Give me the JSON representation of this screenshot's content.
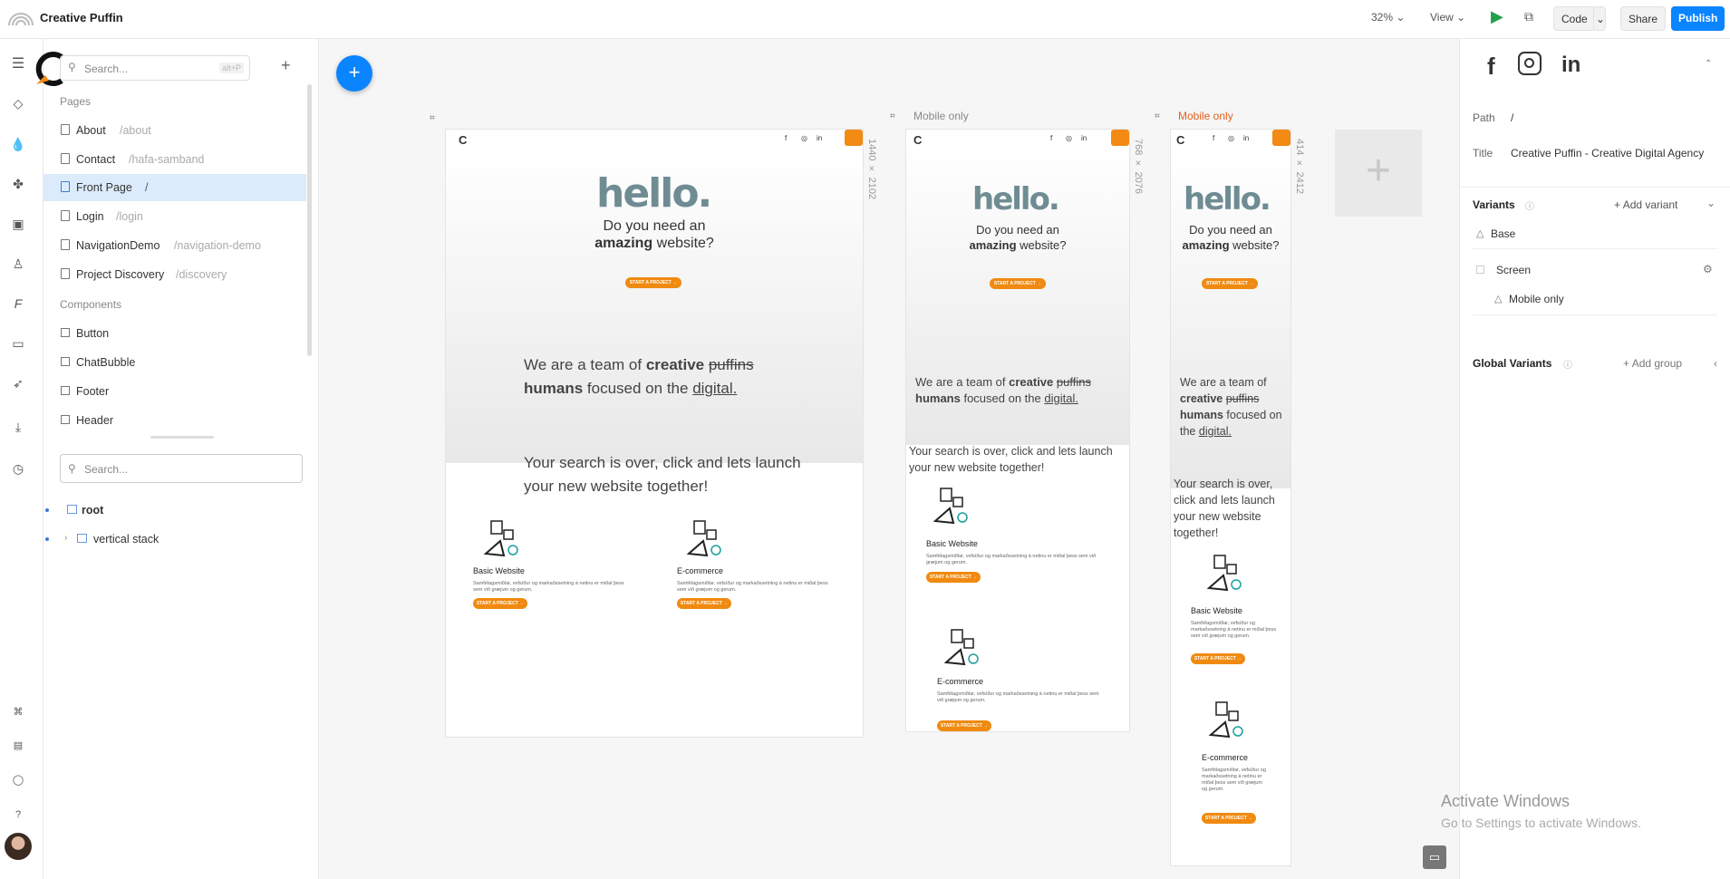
{
  "app": {
    "title": "Creative Puffin"
  },
  "topbar": {
    "zoom": "32%",
    "view_label": "View",
    "code_label": "Code",
    "share_label": "Share",
    "publish_label": "Publish",
    "accent": "#0a84ff"
  },
  "left": {
    "search_placeholder": "Search...",
    "search_shortcut": "alt+P",
    "pages_heading": "Pages",
    "pages": [
      {
        "name": "About",
        "path": "/about"
      },
      {
        "name": "Contact",
        "path": "/hafa-samband"
      },
      {
        "name": "Front Page",
        "path": "/"
      },
      {
        "name": "Login",
        "path": "/login"
      },
      {
        "name": "NavigationDemo",
        "path": "/navigation-demo"
      },
      {
        "name": "Project Discovery",
        "path": "/discovery"
      }
    ],
    "components_heading": "Components",
    "components": [
      "Button",
      "ChatBubble",
      "Footer",
      "Header"
    ],
    "tree_search_placeholder": "Search...",
    "tree": [
      "root",
      "vertical stack"
    ]
  },
  "canvas": {
    "frames": [
      {
        "label": "",
        "dims": "1440 × 2102"
      },
      {
        "label": "Mobile only",
        "dims": "768 × 2076"
      },
      {
        "label": "Mobile only",
        "dims": "414 × 2412"
      }
    ],
    "hello": "hello.",
    "sub1": "Do you need an",
    "sub2_bold": "amazing",
    "sub2_rest": "website?",
    "cta": "START A PROJECT →",
    "team_we": "We are a team of",
    "team_creative": "creative",
    "team_puffins": "puffins",
    "team_humans": "humans",
    "team_focused": "focused on the",
    "team_digital": "digital.",
    "search_text": "Your search is over, click and lets launch your new website together!",
    "cards": [
      {
        "title": "Basic Website",
        "desc": "Samfélagsmiðlar, vefsíður og markaðssetning á netinu er miðal þess sem við græjum og gerum."
      },
      {
        "title": "E-commerce",
        "desc": "Samfélagsmiðlar, vefsíður og markaðssetning á netinu er miðal þess sem við græjum og gerum."
      }
    ],
    "brand_orange": "#f28a14",
    "mobile_label_color": "#e06020"
  },
  "right": {
    "path_label": "Path",
    "path_value": "/",
    "title_label": "Title",
    "title_value": "Creative Puffin - Creative Digital Agency",
    "variants_heading": "Variants",
    "add_variant": "Add variant",
    "base": "Base",
    "screen": "Screen",
    "mobile_only": "Mobile only",
    "global_variants": "Global Variants",
    "add_group": "Add group"
  },
  "watermark": {
    "line1": "Activate Windows",
    "line2": "Go to Settings to activate Windows."
  }
}
